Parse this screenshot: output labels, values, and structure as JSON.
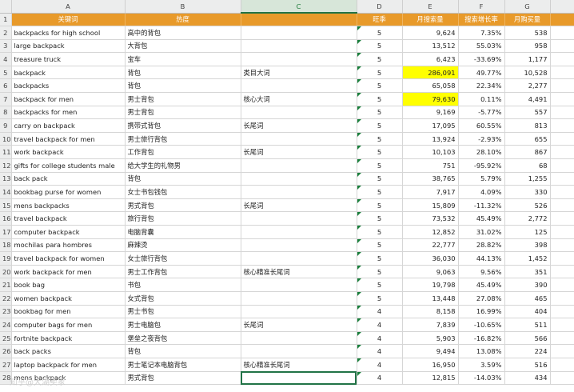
{
  "columns": [
    "A",
    "B",
    "C",
    "D",
    "E",
    "F",
    "G"
  ],
  "header_row": {
    "row_number": "1",
    "cells": [
      "关键词",
      "热度",
      "",
      "旺季",
      "月搜索量",
      "搜索增长率",
      "月购买量"
    ]
  },
  "rows": [
    {
      "n": "2",
      "a": "backpacks for high school",
      "b": "高中的背包",
      "c": "",
      "d": "5",
      "e": "9,624",
      "f": "7.35%",
      "g": "538"
    },
    {
      "n": "3",
      "a": "large backpack",
      "b": "大背包",
      "c": "",
      "d": "5",
      "e": "13,512",
      "f": "55.03%",
      "g": "958"
    },
    {
      "n": "4",
      "a": "treasure truck",
      "b": "宝车",
      "c": "",
      "d": "5",
      "e": "6,423",
      "f": "-33.69%",
      "g": "1,177"
    },
    {
      "n": "5",
      "a": "backpack",
      "b": "背包",
      "c": "类目大词",
      "d": "5",
      "e": "286,091",
      "f": "49.77%",
      "g": "10,528",
      "hl": true
    },
    {
      "n": "6",
      "a": "backpacks",
      "b": "背包",
      "c": "",
      "d": "5",
      "e": "65,058",
      "f": "22.34%",
      "g": "2,277"
    },
    {
      "n": "7",
      "a": "backpack for men",
      "b": "男士背包",
      "c": "核心大词",
      "d": "5",
      "e": "79,630",
      "f": "0.11%",
      "g": "4,491",
      "hl": true
    },
    {
      "n": "8",
      "a": "backpacks for men",
      "b": "男士背包",
      "c": "",
      "d": "5",
      "e": "9,169",
      "f": "-5.77%",
      "g": "557"
    },
    {
      "n": "9",
      "a": "carry on backpack",
      "b": "携带式背包",
      "c": "长尾词",
      "d": "5",
      "e": "17,095",
      "f": "60.55%",
      "g": "813"
    },
    {
      "n": "10",
      "a": "travel backpack for men",
      "b": "男士旅行背包",
      "c": "",
      "d": "5",
      "e": "13,924",
      "f": "-2.93%",
      "g": "655"
    },
    {
      "n": "11",
      "a": "work backpack",
      "b": "工作背包",
      "c": "长尾词",
      "d": "5",
      "e": "10,103",
      "f": "28.10%",
      "g": "867"
    },
    {
      "n": "12",
      "a": "gifts for college students male",
      "b": "给大学生的礼物男",
      "c": "",
      "d": "5",
      "e": "751",
      "f": "-95.92%",
      "g": "68"
    },
    {
      "n": "13",
      "a": "back pack",
      "b": "背包",
      "c": "",
      "d": "5",
      "e": "38,765",
      "f": "5.79%",
      "g": "1,255"
    },
    {
      "n": "14",
      "a": "bookbag purse for women",
      "b": "女士书包钱包",
      "c": "",
      "d": "5",
      "e": "7,917",
      "f": "4.09%",
      "g": "330"
    },
    {
      "n": "15",
      "a": "mens backpacks",
      "b": "男式背包",
      "c": "长尾词",
      "d": "5",
      "e": "15,809",
      "f": "-11.32%",
      "g": "526"
    },
    {
      "n": "16",
      "a": "travel backpack",
      "b": "旅行背包",
      "c": "",
      "d": "5",
      "e": "73,532",
      "f": "45.49%",
      "g": "2,772"
    },
    {
      "n": "17",
      "a": "computer backpack",
      "b": "电脑背囊",
      "c": "",
      "d": "5",
      "e": "12,852",
      "f": "31.02%",
      "g": "125"
    },
    {
      "n": "18",
      "a": "mochilas para hombres",
      "b": "麻辣烫",
      "c": "",
      "d": "5",
      "e": "22,777",
      "f": "28.82%",
      "g": "398"
    },
    {
      "n": "19",
      "a": "travel backpack for women",
      "b": "女士旅行背包",
      "c": "",
      "d": "5",
      "e": "36,030",
      "f": "44.13%",
      "g": "1,452"
    },
    {
      "n": "20",
      "a": "work backpack for men",
      "b": "男士工作背包",
      "c": "核心精准长尾词",
      "d": "5",
      "e": "9,063",
      "f": "9.56%",
      "g": "351"
    },
    {
      "n": "21",
      "a": "book bag",
      "b": "书包",
      "c": "",
      "d": "5",
      "e": "19,798",
      "f": "45.49%",
      "g": "390"
    },
    {
      "n": "22",
      "a": "women backpack",
      "b": "女式背包",
      "c": "",
      "d": "5",
      "e": "13,448",
      "f": "27.08%",
      "g": "465"
    },
    {
      "n": "23",
      "a": "bookbag for men",
      "b": "男士书包",
      "c": "",
      "d": "4",
      "e": "8,158",
      "f": "16.99%",
      "g": "404"
    },
    {
      "n": "24",
      "a": "computer bags for men",
      "b": "男士电脑包",
      "c": "长尾词",
      "d": "4",
      "e": "7,839",
      "f": "-10.65%",
      "g": "511"
    },
    {
      "n": "25",
      "a": "fortnite backpack",
      "b": "堡垒之夜背包",
      "c": "",
      "d": "4",
      "e": "5,903",
      "f": "-16.82%",
      "g": "566"
    },
    {
      "n": "26",
      "a": "back packs",
      "b": "背包",
      "c": "",
      "d": "4",
      "e": "9,494",
      "f": "13.08%",
      "g": "224"
    },
    {
      "n": "27",
      "a": "laptop backpack for men",
      "b": "男士笔记本电脑背包",
      "c": "核心精准长尾词",
      "d": "4",
      "e": "16,950",
      "f": "3.59%",
      "g": "516"
    },
    {
      "n": "28",
      "a": "mens backpack",
      "b": "男式背包",
      "c": "",
      "d": "4",
      "e": "12,815",
      "f": "-14.03%",
      "g": "434"
    }
  ],
  "watermark": "知乎@大湖卖家",
  "colors": {
    "header_orange": "#e89a2a",
    "highlight": "#ffff00",
    "selection": "#217346"
  }
}
